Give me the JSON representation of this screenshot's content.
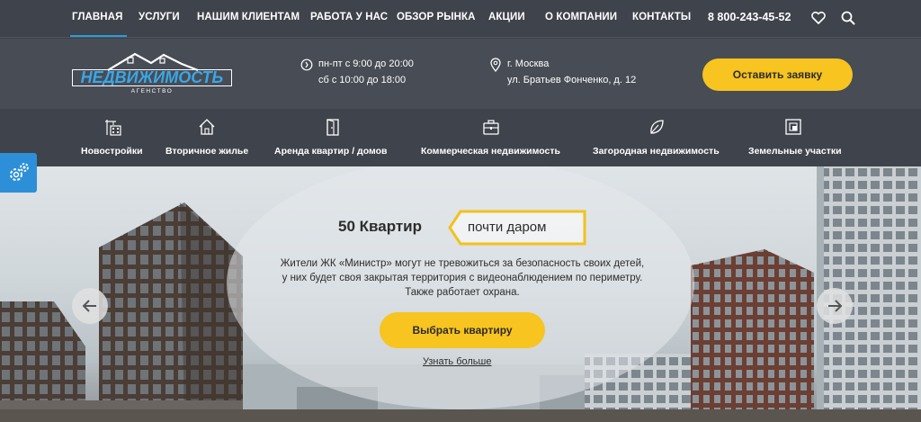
{
  "topnav": {
    "items": [
      {
        "label": "ГЛАВНАЯ",
        "active": true
      },
      {
        "label": "УСЛУГИ"
      },
      {
        "label": "НАШИМ КЛИЕНТАМ"
      },
      {
        "label": "РАБОТА У НАС"
      },
      {
        "label": "ОБЗОР РЫНКА"
      },
      {
        "label": "АКЦИИ"
      },
      {
        "label": "О КОМПАНИИ"
      },
      {
        "label": "КОНТАКТЫ"
      }
    ],
    "phone": "8 800-243-45-52",
    "icons": [
      "heart-icon",
      "search-icon"
    ]
  },
  "header": {
    "logo_text": "НЕДВИЖИМОСТЬ",
    "logo_sub": "АГЕНСТВО",
    "hours_1": "пн-пт с 9:00 до 20:00",
    "hours_2": "сб с 10:00 до 18:00",
    "city": "г. Москва",
    "street": "ул. Братьев Фонченко, д. 12",
    "cta": "Оставить заявку",
    "cta_color": "#f7c420"
  },
  "categories": [
    {
      "label": "Новостройки",
      "icon": "crane-building-icon"
    },
    {
      "label": "Вторичное жилье",
      "icon": "house-icon"
    },
    {
      "label": "Аренда квартир / домов",
      "icon": "door-icon"
    },
    {
      "label": "Коммерческая недвижимость",
      "icon": "briefcase-icon"
    },
    {
      "label": "Загородная недвижимость",
      "icon": "leaf-icon"
    },
    {
      "label": "Земельные участки",
      "icon": "land-plot-icon"
    }
  ],
  "hero": {
    "title": "50 Квартир",
    "badge": "почти даром",
    "description": "Жители ЖК «Министр» могут не тревожиться за безопасность своих детей, у них будет своя закрытая территория с видеонаблюдением по периметру. Также работает охрана.",
    "button": "Выбрать квартиру",
    "more": "Узнать больше"
  },
  "colors": {
    "accent": "#f7c420",
    "brand_blue": "#2b9cd8",
    "nav_bg": "#3e434c"
  }
}
